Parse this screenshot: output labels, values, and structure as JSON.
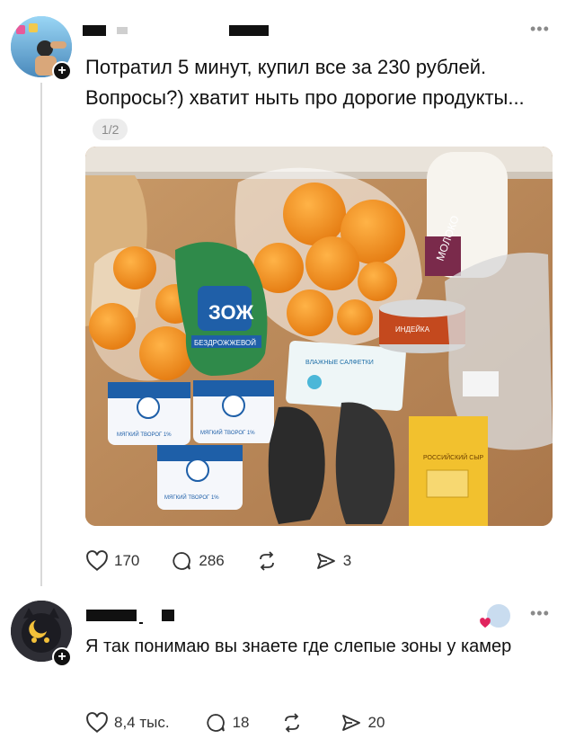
{
  "post": {
    "text": "Потратил 5 минут, купил все за 230 рублей. Вопросы?) хватит ныть про дорогие продукты...",
    "pager": "1/2",
    "photo_labels": {
      "cottage_cheese": "МЯГКИЙ ТВОРОГ 1%",
      "bag_brand": "ЗОЖ",
      "bag_sub": "БЕЗДРОЖЖЕВОЙ",
      "wipes": "ВЛАЖНЫЕ САЛФЕТКИ",
      "can": "ИНДЕЙКА",
      "cheese": "РОССИЙСКИЙ СЫР",
      "milk": "МОЛОКО"
    },
    "actions": {
      "likes": "170",
      "comments": "286",
      "shares": "3"
    }
  },
  "comment": {
    "text": "Я так понимаю вы знаете где слепые зоны у камер",
    "actions": {
      "likes": "8,4 тыс.",
      "comments": "18",
      "shares": "20"
    }
  },
  "colors": {
    "accent": "#111111",
    "muted": "#8a8a8a",
    "heart": "#e0245e"
  }
}
